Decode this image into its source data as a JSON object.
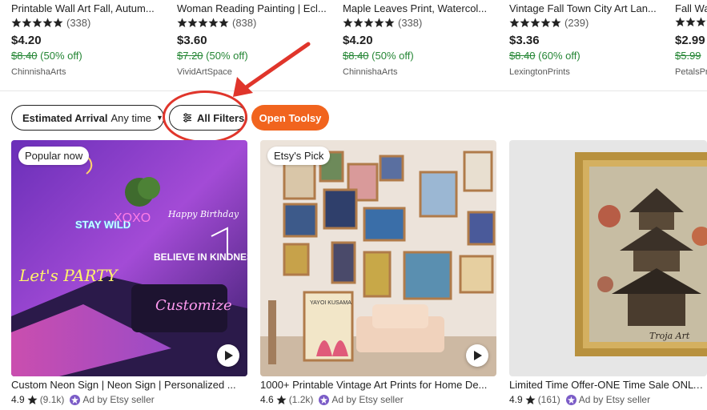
{
  "top_products": [
    {
      "title": "Printable Wall Art Fall, Autum...",
      "rating_count": "(338)",
      "price": "$4.20",
      "original_price": "$8.40",
      "discount": "(50% off)",
      "shop": "ChinnishaArts"
    },
    {
      "title": "Woman Reading Painting | Ecl...",
      "rating_count": "(838)",
      "price": "$3.60",
      "original_price": "$7.20",
      "discount": "(50% off)",
      "shop": "VividArtSpace"
    },
    {
      "title": "Maple Leaves Print, Watercol...",
      "rating_count": "(338)",
      "price": "$4.20",
      "original_price": "$8.40",
      "discount": "(50% off)",
      "shop": "ChinnishaArts"
    },
    {
      "title": "Vintage Fall Town City Art Lan...",
      "rating_count": "(239)",
      "price": "$3.36",
      "original_price": "$8.40",
      "discount": "(60% off)",
      "shop": "LexingtonPrints"
    },
    {
      "title": "Fall Wa",
      "rating_count": "",
      "price": "$2.99",
      "original_price": "$5.99",
      "discount": "",
      "shop": "PetalsPr"
    }
  ],
  "filters": {
    "arrival_label": "Estimated Arrival",
    "arrival_value": "Any time",
    "all_filters_label": "All Filters",
    "toolsy_label": "Open Toolsy"
  },
  "listings": [
    {
      "badge": "Popular now",
      "title": "Custom Neon Sign | Neon Sign | Personalized ...",
      "rating": "4.9",
      "rating_count": "(9.1k)",
      "ad_label": "Ad by Etsy seller",
      "has_video": true
    },
    {
      "badge": "Etsy's Pick",
      "title": "1000+ Printable Vintage Art Prints for Home De...",
      "rating": "4.6",
      "rating_count": "(1.2k)",
      "ad_label": "Ad by Etsy seller",
      "has_video": true
    },
    {
      "badge": "",
      "title": "Limited Time Offer-ONE Time Sale ONLY | ...",
      "rating": "4.9",
      "rating_count": "(161)",
      "ad_label": "Ad by Etsy seller",
      "has_video": false
    }
  ],
  "image_texts": {
    "neon_1": "STAY WILD",
    "neon_2": "XOXO",
    "neon_3": "Let's PARTY",
    "neon_4": "BELIEVE IN KINDNESS",
    "neon_5": "Customize",
    "neon_6": "Happy Birthday",
    "gallery_poster": "YAYOI KUSAMA",
    "painting_signature": "Troja Art"
  },
  "colors": {
    "accent_orange": "#f1641e",
    "discount_green": "#258635",
    "annotation_red": "#e0352b",
    "star_black": "#222222",
    "etsy_seller_purple": "#7b5cc7"
  },
  "icons": {
    "star": "star-icon",
    "filters": "sliders-icon",
    "caret": "chevron-down-icon",
    "play": "play-icon",
    "seller_badge": "etsy-seller-icon"
  }
}
